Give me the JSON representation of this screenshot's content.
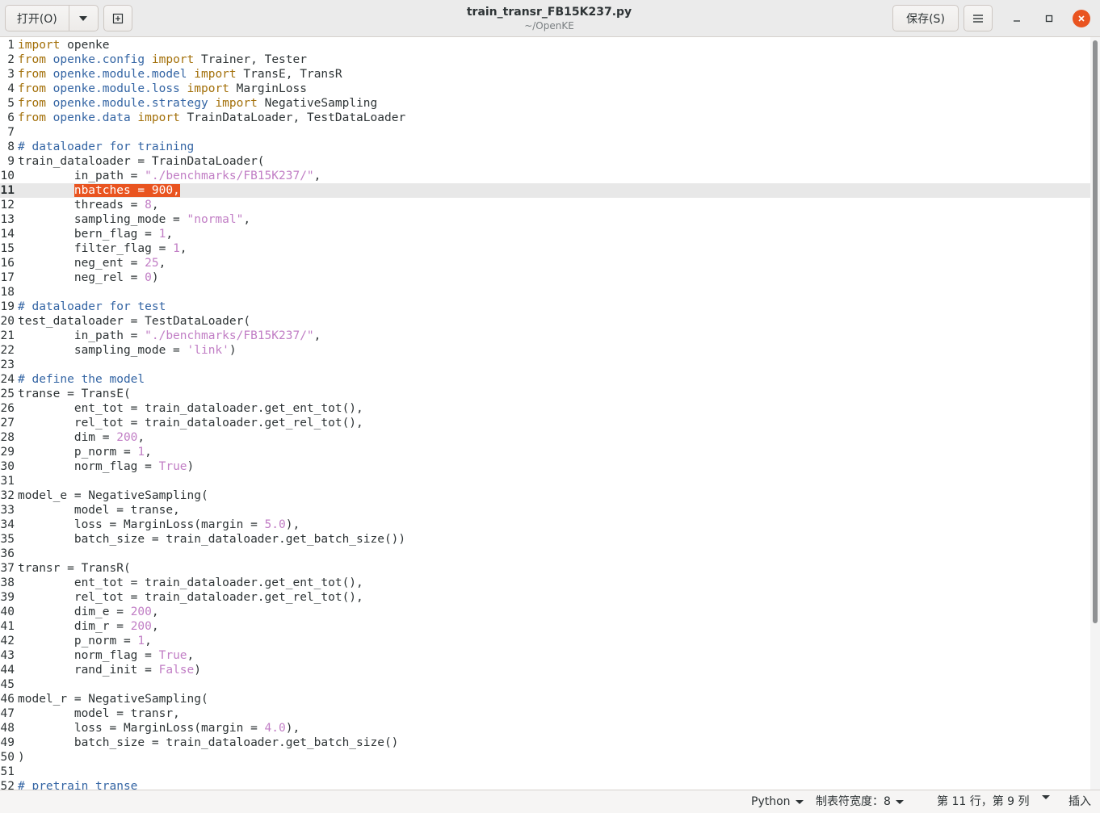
{
  "header": {
    "open_label": "打开(O)",
    "title": "train_transr_FB15K237.py",
    "subtitle": "~/OpenKE",
    "save_label": "保存(S)"
  },
  "editor": {
    "current_line": 11,
    "lines": [
      {
        "n": 1,
        "t": [
          [
            "kw",
            "import"
          ],
          [
            "",
            "openke"
          ]
        ]
      },
      {
        "n": 2,
        "t": [
          [
            "kw",
            "from"
          ],
          [
            "mod",
            "openke.config"
          ],
          [
            "kw",
            "import"
          ],
          [
            "",
            "Trainer, Tester"
          ]
        ]
      },
      {
        "n": 3,
        "t": [
          [
            "kw",
            "from"
          ],
          [
            "mod",
            "openke.module.model"
          ],
          [
            "kw",
            "import"
          ],
          [
            "",
            "TransE, TransR"
          ]
        ]
      },
      {
        "n": 4,
        "t": [
          [
            "kw",
            "from"
          ],
          [
            "mod",
            "openke.module.loss"
          ],
          [
            "kw",
            "import"
          ],
          [
            "",
            "MarginLoss"
          ]
        ]
      },
      {
        "n": 5,
        "t": [
          [
            "kw",
            "from"
          ],
          [
            "mod",
            "openke.module.strategy"
          ],
          [
            "kw",
            "import"
          ],
          [
            "",
            "NegativeSampling"
          ]
        ]
      },
      {
        "n": 6,
        "t": [
          [
            "kw",
            "from"
          ],
          [
            "mod",
            "openke.data"
          ],
          [
            "kw",
            "import"
          ],
          [
            "",
            "TrainDataLoader, TestDataLoader"
          ]
        ]
      },
      {
        "n": 7,
        "t": []
      },
      {
        "n": 8,
        "t": [
          [
            "cm",
            "# dataloader for training"
          ]
        ]
      },
      {
        "n": 9,
        "t": [
          [
            "",
            "train_dataloader = TrainDataLoader("
          ]
        ]
      },
      {
        "n": 10,
        "t": [
          [
            "",
            "\tin_path = "
          ],
          [
            "str",
            "\"./benchmarks/FB15K237/\""
          ],
          [
            "",
            ","
          ]
        ]
      },
      {
        "n": 11,
        "t": [
          [
            "",
            "\t"
          ],
          [
            "sel",
            "nbatches = 900,"
          ]
        ]
      },
      {
        "n": 12,
        "t": [
          [
            "",
            "\tthreads = "
          ],
          [
            "num",
            "8"
          ],
          [
            "",
            ","
          ]
        ]
      },
      {
        "n": 13,
        "t": [
          [
            "",
            "\tsampling_mode = "
          ],
          [
            "str",
            "\"normal\""
          ],
          [
            "",
            ","
          ]
        ]
      },
      {
        "n": 14,
        "t": [
          [
            "",
            "\tbern_flag = "
          ],
          [
            "num",
            "1"
          ],
          [
            "",
            ","
          ]
        ]
      },
      {
        "n": 15,
        "t": [
          [
            "",
            "\tfilter_flag = "
          ],
          [
            "num",
            "1"
          ],
          [
            "",
            ","
          ]
        ]
      },
      {
        "n": 16,
        "t": [
          [
            "",
            "\tneg_ent = "
          ],
          [
            "num",
            "25"
          ],
          [
            "",
            ","
          ]
        ]
      },
      {
        "n": 17,
        "t": [
          [
            "",
            "\tneg_rel = "
          ],
          [
            "num",
            "0"
          ],
          [
            "",
            ")"
          ]
        ]
      },
      {
        "n": 18,
        "t": []
      },
      {
        "n": 19,
        "t": [
          [
            "cm",
            "# dataloader for test"
          ]
        ]
      },
      {
        "n": 20,
        "t": [
          [
            "",
            "test_dataloader = TestDataLoader("
          ]
        ]
      },
      {
        "n": 21,
        "t": [
          [
            "",
            "\tin_path = "
          ],
          [
            "str",
            "\"./benchmarks/FB15K237/\""
          ],
          [
            "",
            ","
          ]
        ]
      },
      {
        "n": 22,
        "t": [
          [
            "",
            "\tsampling_mode = "
          ],
          [
            "str",
            "'link'"
          ],
          [
            "",
            ")"
          ]
        ]
      },
      {
        "n": 23,
        "t": []
      },
      {
        "n": 24,
        "t": [
          [
            "cm",
            "# define the model"
          ]
        ]
      },
      {
        "n": 25,
        "t": [
          [
            "",
            "transe = TransE("
          ]
        ]
      },
      {
        "n": 26,
        "t": [
          [
            "",
            "\tent_tot = train_dataloader.get_ent_tot(),"
          ]
        ]
      },
      {
        "n": 27,
        "t": [
          [
            "",
            "\trel_tot = train_dataloader.get_rel_tot(),"
          ]
        ]
      },
      {
        "n": 28,
        "t": [
          [
            "",
            "\tdim = "
          ],
          [
            "num",
            "200"
          ],
          [
            "",
            ","
          ]
        ]
      },
      {
        "n": 29,
        "t": [
          [
            "",
            "\tp_norm = "
          ],
          [
            "num",
            "1"
          ],
          [
            "",
            ","
          ]
        ]
      },
      {
        "n": 30,
        "t": [
          [
            "",
            "\tnorm_flag = "
          ],
          [
            "num",
            "True"
          ],
          [
            "",
            ")"
          ]
        ]
      },
      {
        "n": 31,
        "t": []
      },
      {
        "n": 32,
        "t": [
          [
            "",
            "model_e = NegativeSampling("
          ]
        ]
      },
      {
        "n": 33,
        "t": [
          [
            "",
            "\tmodel = transe,"
          ]
        ]
      },
      {
        "n": 34,
        "t": [
          [
            "",
            "\tloss = MarginLoss(margin = "
          ],
          [
            "num",
            "5.0"
          ],
          [
            "",
            "),"
          ]
        ]
      },
      {
        "n": 35,
        "t": [
          [
            "",
            "\tbatch_size = train_dataloader.get_batch_size())"
          ]
        ]
      },
      {
        "n": 36,
        "t": []
      },
      {
        "n": 37,
        "t": [
          [
            "",
            "transr = TransR("
          ]
        ]
      },
      {
        "n": 38,
        "t": [
          [
            "",
            "\tent_tot = train_dataloader.get_ent_tot(),"
          ]
        ]
      },
      {
        "n": 39,
        "t": [
          [
            "",
            "\trel_tot = train_dataloader.get_rel_tot(),"
          ]
        ]
      },
      {
        "n": 40,
        "t": [
          [
            "",
            "\tdim_e = "
          ],
          [
            "num",
            "200"
          ],
          [
            "",
            ","
          ]
        ]
      },
      {
        "n": 41,
        "t": [
          [
            "",
            "\tdim_r = "
          ],
          [
            "num",
            "200"
          ],
          [
            "",
            ","
          ]
        ]
      },
      {
        "n": 42,
        "t": [
          [
            "",
            "\tp_norm = "
          ],
          [
            "num",
            "1"
          ],
          [
            "",
            ","
          ]
        ]
      },
      {
        "n": 43,
        "t": [
          [
            "",
            "\tnorm_flag = "
          ],
          [
            "num",
            "True"
          ],
          [
            "",
            ","
          ]
        ]
      },
      {
        "n": 44,
        "t": [
          [
            "",
            "\trand_init = "
          ],
          [
            "num",
            "False"
          ],
          [
            "",
            ")"
          ]
        ]
      },
      {
        "n": 45,
        "t": []
      },
      {
        "n": 46,
        "t": [
          [
            "",
            "model_r = NegativeSampling("
          ]
        ]
      },
      {
        "n": 47,
        "t": [
          [
            "",
            "\tmodel = transr,"
          ]
        ]
      },
      {
        "n": 48,
        "t": [
          [
            "",
            "\tloss = MarginLoss(margin = "
          ],
          [
            "num",
            "4.0"
          ],
          [
            "",
            "),"
          ]
        ]
      },
      {
        "n": 49,
        "t": [
          [
            "",
            "\tbatch_size = train_dataloader.get_batch_size()"
          ]
        ]
      },
      {
        "n": 50,
        "t": [
          [
            "",
            ")"
          ]
        ]
      },
      {
        "n": 51,
        "t": []
      },
      {
        "n": 52,
        "t": [
          [
            "cm",
            "# pretrain transe"
          ]
        ]
      }
    ]
  },
  "statusbar": {
    "language": "Python",
    "tab_width": "制表符宽度：8",
    "position": "第 11 行，第 9 列",
    "insert_mode": "插入"
  },
  "colors": {
    "keyword": "#a3700a",
    "module": "#3465a4",
    "string": "#c17ec5",
    "selection": "#e95420",
    "close_button": "#e95420",
    "current_line": "#e8e8e8"
  }
}
